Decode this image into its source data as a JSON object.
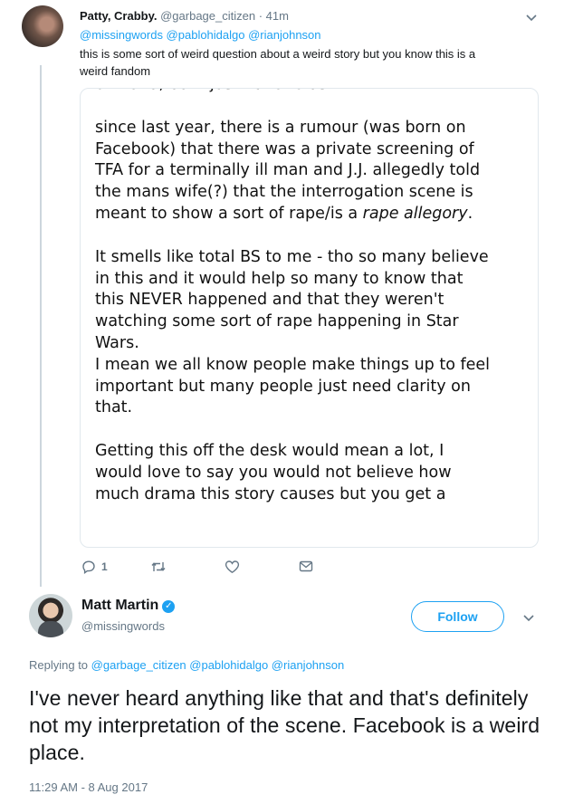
{
  "tweet1": {
    "display_name": "Patty, Crabby.",
    "handle": "@garbage_citizen",
    "time": "· 41m",
    "mentions": "@missingwords @pablohidalgo @rianjohnson",
    "text": "this is some sort of weird question about a weird story but you know this is a weird fandom",
    "media_paragraphs": [
      "of weird, but I just have to ask.",
      "since last year, there is a rumour (was born on Facebook) that there was a private screening of TFA for a terminally ill man and J.J. allegedly told the mans wife(?) that the interrogation scene is meant to show a sort of rape/is a",
      "rape allegory",
      ".",
      "It smells like total BS to me - tho so many believe in this and it would help so many to know that this NEVER happened and that they weren't watching some sort of rape happening in Star Wars.",
      "I mean we all know people make things up to feel important but many people just need clarity on that.",
      "Getting this off the desk would mean a lot, I would love to say you would not believe how much drama this story causes but you get a"
    ],
    "actions": {
      "reply_count": "1",
      "reply_icon": "reply-icon",
      "retweet_icon": "retweet-icon",
      "like_icon": "heart-icon",
      "dm_icon": "envelope-icon"
    }
  },
  "tweet2": {
    "display_name": "Matt Martin",
    "handle": "@missingwords",
    "follow_label": "Follow",
    "replying_prefix": "Replying to",
    "replying_to": "@garbage_citizen @pablohidalgo @rianjohnson",
    "text": "I've never heard anything like that and that's definitely not my interpretation of the scene. Facebook is a weird place.",
    "timestamp": "11:29 AM - 8 Aug 2017"
  },
  "colors": {
    "accent": "#1da1f2",
    "muted": "#657786",
    "border": "#e1e8ed"
  }
}
